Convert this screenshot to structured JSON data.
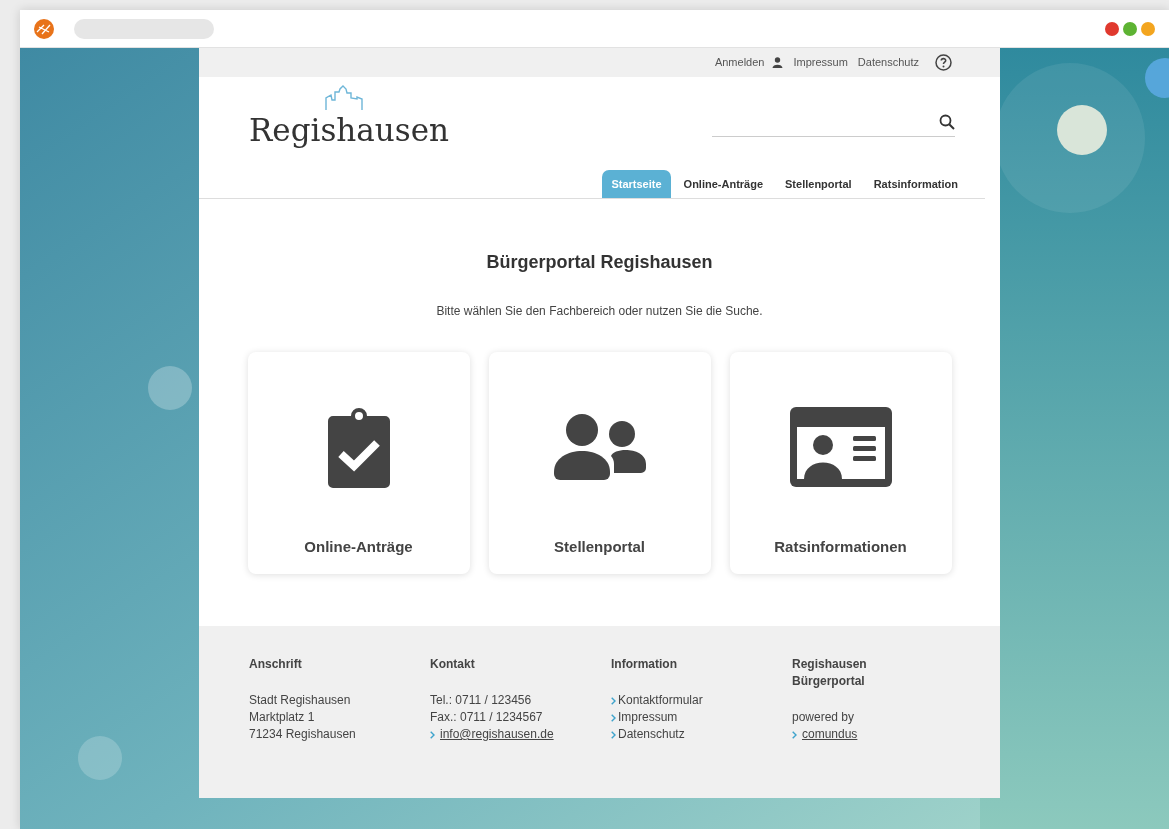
{
  "browser": {
    "dots": [
      {
        "color": "#e0392e"
      },
      {
        "color": "#5db333"
      },
      {
        "color": "#f3a51f"
      }
    ]
  },
  "top_links": [
    {
      "label": "Anmelden",
      "kind": "login"
    },
    {
      "label": "Impressum",
      "kind": "link"
    },
    {
      "label": "Datenschutz",
      "kind": "link"
    },
    {
      "kind": "help"
    }
  ],
  "logo": {
    "text": "Regishausen"
  },
  "tabs": [
    {
      "label": "Startseite",
      "selected": true
    },
    {
      "label": "Online-Anträge",
      "selected": false
    },
    {
      "label": "Stellenportal",
      "selected": false
    },
    {
      "label": "Ratsinformation",
      "selected": false
    }
  ],
  "main": {
    "title": "Bürgerportal Regishausen",
    "subtitle": "Bitte wählen Sie den Fachbereich oder nutzen Sie die Suche."
  },
  "cards": [
    {
      "label": "Online-Anträge",
      "kind": "clipboard"
    },
    {
      "label": "Stellenportal",
      "kind": "people"
    },
    {
      "label": "Ratsinformationen",
      "kind": "idcard"
    }
  ],
  "footer": [
    {
      "heading": "Anschrift",
      "lines": [
        {
          "kind": "text",
          "text": "Stadt Regishausen"
        },
        {
          "kind": "text",
          "text": "Marktplatz 1"
        },
        {
          "kind": "text",
          "text": "71234 Regishausen"
        }
      ]
    },
    {
      "heading": "Kontakt",
      "lines": [
        {
          "kind": "text",
          "text": "Tel.: 0711 / 123456"
        },
        {
          "kind": "text",
          "text": "Fax.: 0711 / 1234567"
        },
        {
          "kind": "link",
          "underlined": true,
          "text": "info@regishausen.de"
        }
      ]
    },
    {
      "heading": "Information",
      "lines": [
        {
          "kind": "link",
          "underlined": false,
          "text": "Kontaktformular"
        },
        {
          "kind": "link",
          "underlined": false,
          "text": "Impressum"
        },
        {
          "kind": "link",
          "underlined": false,
          "text": "Datenschutz"
        }
      ]
    },
    {
      "heading": "Regishausen Bürgerportal",
      "lines": [
        {
          "kind": "text",
          "text": "powered by"
        },
        {
          "kind": "link",
          "underlined": true,
          "text": "comundus"
        }
      ]
    }
  ]
}
